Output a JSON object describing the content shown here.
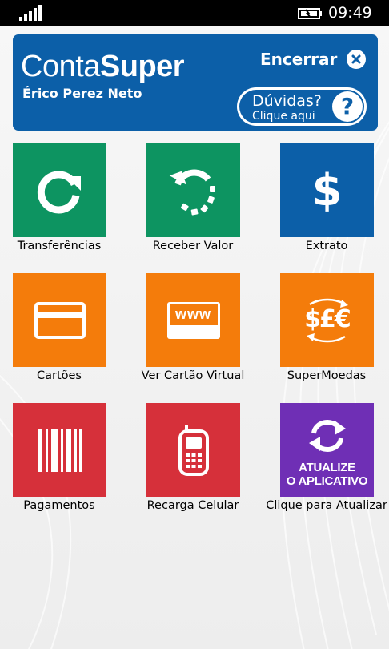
{
  "status_bar": {
    "time": "09:49",
    "signal_icon": "signal-bars-icon",
    "battery_icon": "battery-charging-icon"
  },
  "header": {
    "brand_light": "Conta",
    "brand_bold": "Super",
    "user_name": "Érico Perez Neto",
    "logout_label": "Encerrar",
    "logout_icon": "close-circle-icon",
    "help_title": "Dúvidas?",
    "help_subtitle": "Clique aqui",
    "help_icon_text": "?"
  },
  "tiles": [
    {
      "label": "Transferências",
      "icon": "refresh-arrow-icon",
      "color": "#0d9461"
    },
    {
      "label": "Receber Valor",
      "icon": "receive-circular-arrow-icon",
      "color": "#0d9461"
    },
    {
      "label": "Extrato",
      "icon": "dollar-sign-icon",
      "color": "#0c5fa8"
    },
    {
      "label": "Cartões",
      "icon": "credit-card-icon",
      "color": "#f47c0b"
    },
    {
      "label": "Ver Cartão Virtual",
      "icon": "www-card-icon",
      "color": "#f47c0b"
    },
    {
      "label": "SuperMoedas",
      "icon": "currency-exchange-icon",
      "color": "#f47c0b"
    },
    {
      "label": "Pagamentos",
      "icon": "barcode-icon",
      "color": "#d6303a"
    },
    {
      "label": "Recarga Celular",
      "icon": "mobile-phone-icon",
      "color": "#d6303a"
    },
    {
      "label": "Clique para Atualizar",
      "icon": "sync-arrows-icon",
      "color": "#6f2fb5",
      "badge_line1": "ATUALIZE",
      "badge_line2": "O APLICATIVO"
    }
  ],
  "icon_texts": {
    "www": "www",
    "currency": "$£€",
    "dollar": "$"
  }
}
